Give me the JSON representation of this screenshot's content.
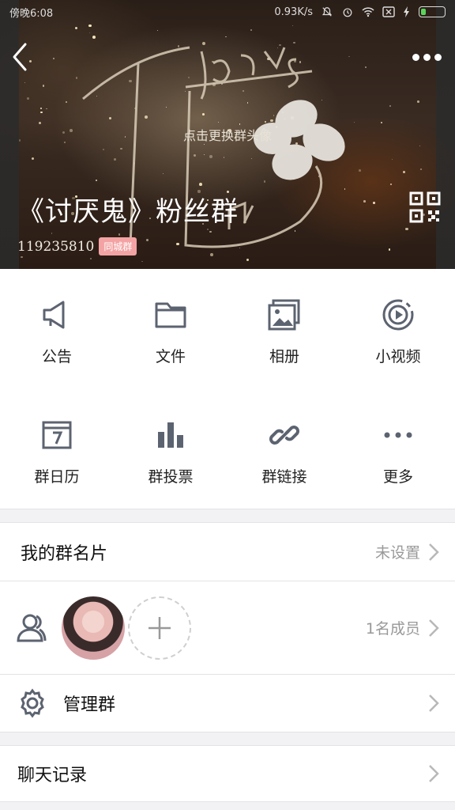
{
  "status": {
    "time": "傍晚6:08",
    "network_speed": "0.93K/s"
  },
  "header": {
    "avatar_hint": "点击更换群头像",
    "group_name": "《讨厌鬼》粉丝群",
    "group_id": "119235810",
    "city_badge": "同城群"
  },
  "grid": [
    {
      "label": "公告",
      "icon": "megaphone-icon"
    },
    {
      "label": "文件",
      "icon": "folder-icon"
    },
    {
      "label": "相册",
      "icon": "album-icon"
    },
    {
      "label": "小视频",
      "icon": "video-icon"
    },
    {
      "label": "群日历",
      "icon": "calendar-icon"
    },
    {
      "label": "群投票",
      "icon": "vote-icon"
    },
    {
      "label": "群链接",
      "icon": "link-icon"
    },
    {
      "label": "更多",
      "icon": "more-dots-icon"
    }
  ],
  "card": {
    "title": "我的群名片",
    "value": "未设置"
  },
  "members": {
    "count_label": "1名成员"
  },
  "manage": {
    "title": "管理群"
  },
  "chat_history": {
    "title": "聊天记录"
  },
  "colors": {
    "icon_gray": "#5c6370",
    "badge_pink": "#f3a3a3",
    "battery_green": "#5bd45b"
  }
}
